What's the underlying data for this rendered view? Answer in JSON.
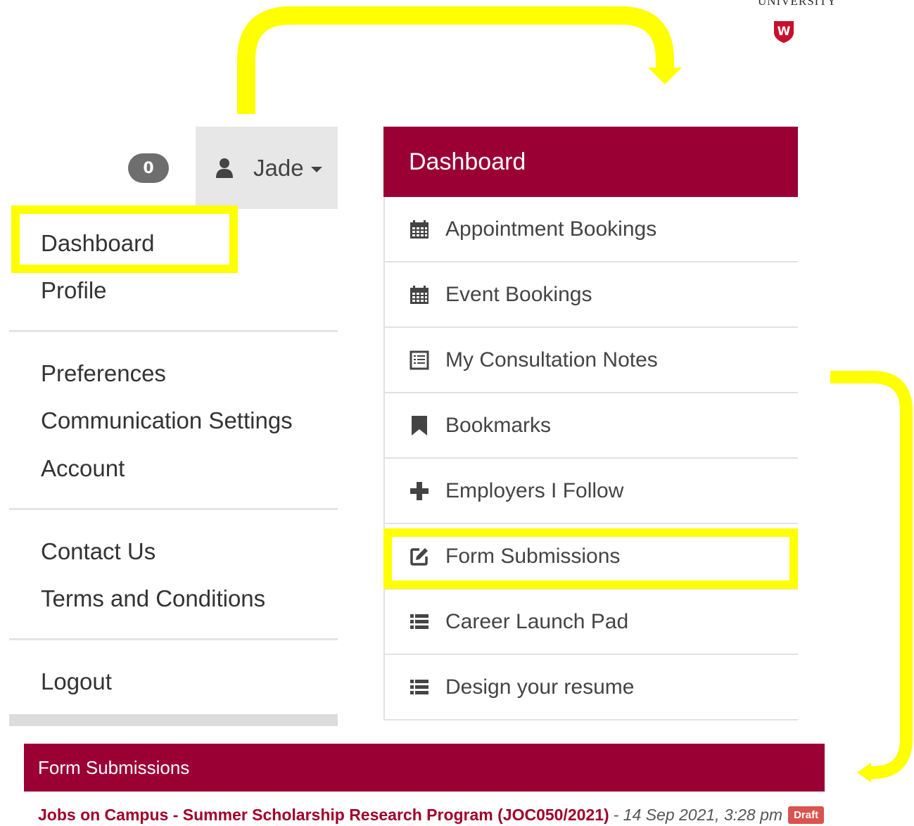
{
  "logo": {
    "text": "UNIVERSITY",
    "letter": "W"
  },
  "user_nav": {
    "notification_count": "0",
    "user_name": "Jade",
    "menu": {
      "dashboard": "Dashboard",
      "profile": "Profile",
      "preferences": "Preferences",
      "communication_settings": "Communication Settings",
      "account": "Account",
      "contact_us": "Contact Us",
      "terms": "Terms and Conditions",
      "logout": "Logout"
    }
  },
  "dashboard": {
    "title": "Dashboard",
    "items": [
      {
        "label": "Appointment Bookings",
        "icon": "calendar-icon"
      },
      {
        "label": "Event Bookings",
        "icon": "calendar-icon"
      },
      {
        "label": "My Consultation Notes",
        "icon": "notes-icon"
      },
      {
        "label": "Bookmarks",
        "icon": "bookmark-icon"
      },
      {
        "label": "Employers I Follow",
        "icon": "plus-icon"
      },
      {
        "label": "Form Submissions",
        "icon": "edit-icon"
      },
      {
        "label": "Career Launch Pad",
        "icon": "list-icon"
      },
      {
        "label": "Design your resume",
        "icon": "list-icon"
      }
    ]
  },
  "form_submissions": {
    "title": "Form Submissions",
    "entries": [
      {
        "link": "Jobs on Campus - Summer Scholarship Research Program (JOC050/2021)",
        "date": "- 14 Sep 2021, 3:28 pm",
        "status": "Draft"
      }
    ]
  },
  "colors": {
    "brand": "#9b0035",
    "highlight": "#ffff00",
    "badge_draft": "#d9534f",
    "user_toggle_bg": "#e7e7e7",
    "notification_badge": "#6e6e6e"
  }
}
